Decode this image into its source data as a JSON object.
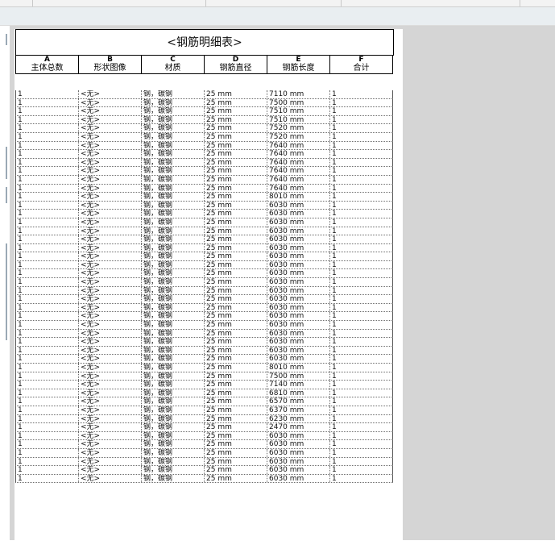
{
  "schedule": {
    "title": "<钢筋明细表>",
    "column_letters": [
      "A",
      "B",
      "C",
      "D",
      "E",
      "F"
    ],
    "column_headers": [
      "主体总数",
      "形状图像",
      "材质",
      "钢筋直径",
      "钢筋长度",
      "合计"
    ],
    "rows": [
      [
        "1",
        "<无>",
        "钢，碳钢",
        "25 mm",
        "7110 mm",
        "1"
      ],
      [
        "1",
        "<无>",
        "钢，碳钢",
        "25 mm",
        "7500 mm",
        "1"
      ],
      [
        "1",
        "<无>",
        "钢，碳钢",
        "25 mm",
        "7510 mm",
        "1"
      ],
      [
        "1",
        "<无>",
        "钢，碳钢",
        "25 mm",
        "7510 mm",
        "1"
      ],
      [
        "1",
        "<无>",
        "钢，碳钢",
        "25 mm",
        "7520 mm",
        "1"
      ],
      [
        "1",
        "<无>",
        "钢，碳钢",
        "25 mm",
        "7520 mm",
        "1"
      ],
      [
        "1",
        "<无>",
        "钢，碳钢",
        "25 mm",
        "7640 mm",
        "1"
      ],
      [
        "1",
        "<无>",
        "钢，碳钢",
        "25 mm",
        "7640 mm",
        "1"
      ],
      [
        "1",
        "<无>",
        "钢，碳钢",
        "25 mm",
        "7640 mm",
        "1"
      ],
      [
        "1",
        "<无>",
        "钢，碳钢",
        "25 mm",
        "7640 mm",
        "1"
      ],
      [
        "1",
        "<无>",
        "钢，碳钢",
        "25 mm",
        "7640 mm",
        "1"
      ],
      [
        "1",
        "<无>",
        "钢，碳钢",
        "25 mm",
        "7640 mm",
        "1"
      ],
      [
        "1",
        "<无>",
        "钢，碳钢",
        "25 mm",
        "8010 mm",
        "1"
      ],
      [
        "1",
        "<无>",
        "钢，碳钢",
        "25 mm",
        "6030 mm",
        "1"
      ],
      [
        "1",
        "<无>",
        "钢，碳钢",
        "25 mm",
        "6030 mm",
        "1"
      ],
      [
        "1",
        "<无>",
        "钢，碳钢",
        "25 mm",
        "6030 mm",
        "1"
      ],
      [
        "1",
        "<无>",
        "钢，碳钢",
        "25 mm",
        "6030 mm",
        "1"
      ],
      [
        "1",
        "<无>",
        "钢，碳钢",
        "25 mm",
        "6030 mm",
        "1"
      ],
      [
        "1",
        "<无>",
        "钢，碳钢",
        "25 mm",
        "6030 mm",
        "1"
      ],
      [
        "1",
        "<无>",
        "钢，碳钢",
        "25 mm",
        "6030 mm",
        "1"
      ],
      [
        "1",
        "<无>",
        "钢，碳钢",
        "25 mm",
        "6030 mm",
        "1"
      ],
      [
        "1",
        "<无>",
        "钢，碳钢",
        "25 mm",
        "6030 mm",
        "1"
      ],
      [
        "1",
        "<无>",
        "钢，碳钢",
        "25 mm",
        "6030 mm",
        "1"
      ],
      [
        "1",
        "<无>",
        "钢，碳钢",
        "25 mm",
        "6030 mm",
        "1"
      ],
      [
        "1",
        "<无>",
        "钢，碳钢",
        "25 mm",
        "6030 mm",
        "1"
      ],
      [
        "1",
        "<无>",
        "钢，碳钢",
        "25 mm",
        "6030 mm",
        "1"
      ],
      [
        "1",
        "<无>",
        "钢，碳钢",
        "25 mm",
        "6030 mm",
        "1"
      ],
      [
        "1",
        "<无>",
        "钢，碳钢",
        "25 mm",
        "6030 mm",
        "1"
      ],
      [
        "1",
        "<无>",
        "钢，碳钢",
        "25 mm",
        "6030 mm",
        "1"
      ],
      [
        "1",
        "<无>",
        "钢，碳钢",
        "25 mm",
        "6030 mm",
        "1"
      ],
      [
        "1",
        "<无>",
        "钢，碳钢",
        "25 mm",
        "6030 mm",
        "1"
      ],
      [
        "1",
        "<无>",
        "钢，碳钢",
        "25 mm",
        "6030 mm",
        "1"
      ],
      [
        "1",
        "<无>",
        "钢，碳钢",
        "25 mm",
        "8010 mm",
        "1"
      ],
      [
        "1",
        "<无>",
        "钢，碳钢",
        "25 mm",
        "7500 mm",
        "1"
      ],
      [
        "1",
        "<无>",
        "钢，碳钢",
        "25 mm",
        "7140 mm",
        "1"
      ],
      [
        "1",
        "<无>",
        "钢，碳钢",
        "25 mm",
        "6810 mm",
        "1"
      ],
      [
        "1",
        "<无>",
        "钢，碳钢",
        "25 mm",
        "6570 mm",
        "1"
      ],
      [
        "1",
        "<无>",
        "钢，碳钢",
        "25 mm",
        "6370 mm",
        "1"
      ],
      [
        "1",
        "<无>",
        "钢，碳钢",
        "25 mm",
        "6230 mm",
        "1"
      ],
      [
        "1",
        "<无>",
        "钢，碳钢",
        "25 mm",
        "2470 mm",
        "1"
      ],
      [
        "1",
        "<无>",
        "钢，碳钢",
        "25 mm",
        "6030 mm",
        "1"
      ],
      [
        "1",
        "<无>",
        "钢，碳钢",
        "25 mm",
        "6030 mm",
        "1"
      ],
      [
        "1",
        "<无>",
        "钢，碳钢",
        "25 mm",
        "6030 mm",
        "1"
      ],
      [
        "1",
        "<无>",
        "钢，碳钢",
        "25 mm",
        "6030 mm",
        "1"
      ],
      [
        "1",
        "<无>",
        "钢，碳钢",
        "25 mm",
        "6030 mm",
        "1"
      ],
      [
        "1",
        "<无>",
        "钢，碳钢",
        "25 mm",
        "6030 mm",
        "1"
      ]
    ]
  }
}
